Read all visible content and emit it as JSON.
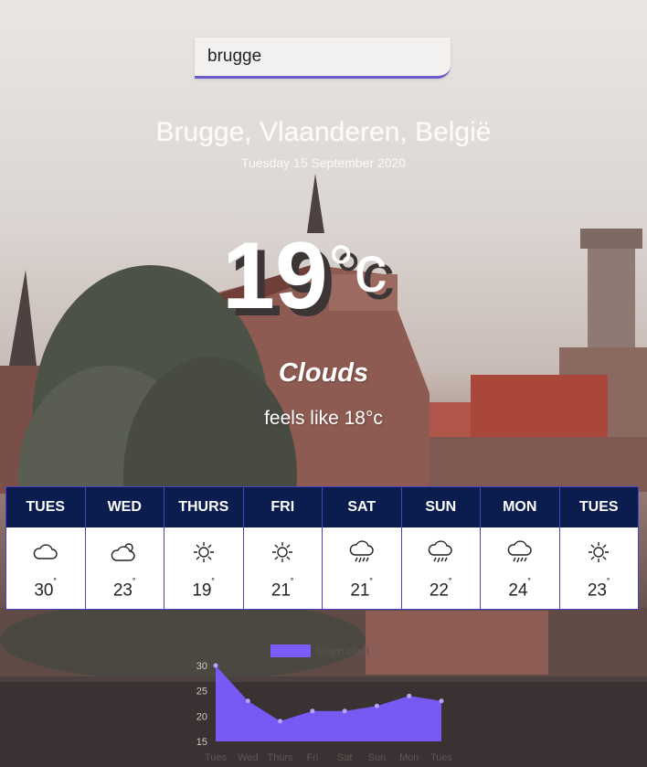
{
  "search": {
    "value": "brugge"
  },
  "location": "Brugge, Vlaanderen, België",
  "date": "Tuesday 15 September 2020",
  "current": {
    "temp": "19",
    "unit": "°c",
    "condition": "Clouds",
    "feels_like": "feels like 18°c"
  },
  "forecast": [
    {
      "day": "TUES",
      "icon": "cloud-icon",
      "temp": "30",
      "deg": "˚"
    },
    {
      "day": "WED",
      "icon": "cloud-sun-icon",
      "temp": "23",
      "deg": "˚"
    },
    {
      "day": "THURS",
      "icon": "sun-icon",
      "temp": "19",
      "deg": "˚"
    },
    {
      "day": "FRI",
      "icon": "sun-icon",
      "temp": "21",
      "deg": "˚"
    },
    {
      "day": "SAT",
      "icon": "rain-icon",
      "temp": "21",
      "deg": "˚"
    },
    {
      "day": "SUN",
      "icon": "rain-icon",
      "temp": "22",
      "deg": "˚"
    },
    {
      "day": "MON",
      "icon": "rain-icon",
      "temp": "24",
      "deg": "˚"
    },
    {
      "day": "TUES",
      "icon": "sun-icon",
      "temp": "23",
      "deg": "˚"
    }
  ],
  "colors": {
    "accent": "#6a5acd",
    "header": "#0b1d4f",
    "chart_fill": "#7a5cff"
  },
  "chart_data": {
    "type": "area",
    "legend": "Graph chart",
    "categories": [
      "Tues",
      "Wed",
      "Thurs",
      "Fri",
      "Sat",
      "Sun",
      "Mon",
      "Tues"
    ],
    "values": [
      30,
      23,
      19,
      21,
      21,
      22,
      24,
      23
    ],
    "yticks": [
      "30",
      "25",
      "20",
      "15"
    ],
    "ylim": [
      15,
      30
    ],
    "legend_position": "top"
  }
}
